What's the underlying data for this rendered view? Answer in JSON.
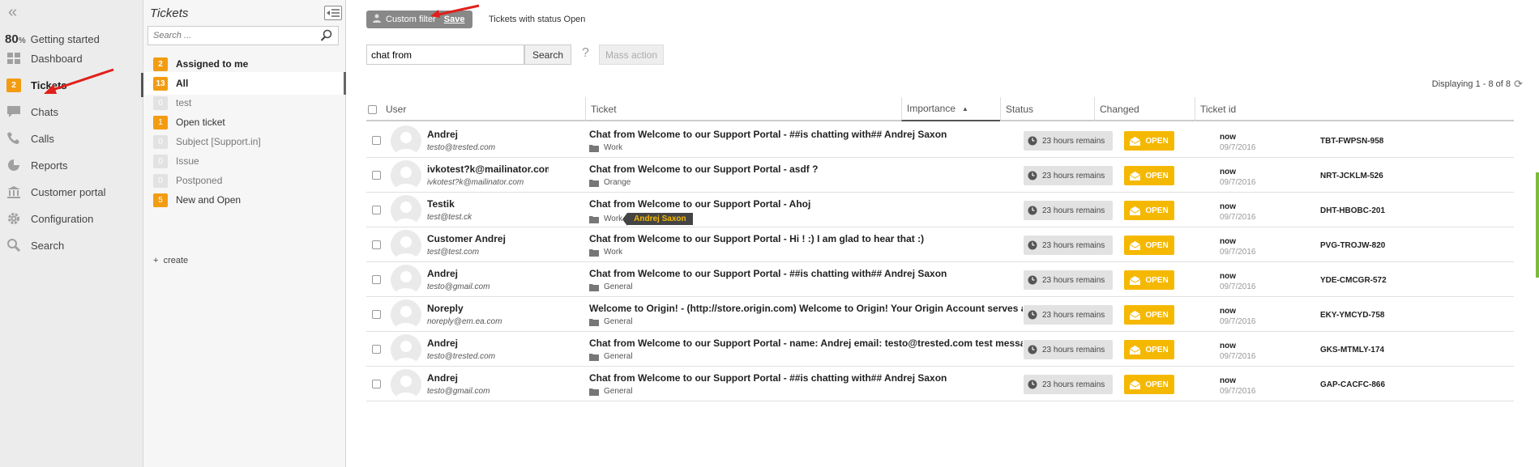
{
  "nav": {
    "collapse_icon": "double-chevron-left-icon",
    "progress": {
      "value": "80",
      "unit": "%",
      "label": "Getting started"
    },
    "items": [
      {
        "label": "Dashboard",
        "icon": "dashboard-icon"
      },
      {
        "label": "Tickets",
        "icon": "ticket-icon",
        "badge": "2"
      },
      {
        "label": "Chats",
        "icon": "chat-bubble-icon"
      },
      {
        "label": "Calls",
        "icon": "phone-icon"
      },
      {
        "label": "Reports",
        "icon": "pie-chart-icon"
      },
      {
        "label": "Customer portal",
        "icon": "bank-building-icon"
      },
      {
        "label": "Configuration",
        "icon": "gear-icon"
      },
      {
        "label": "Search",
        "icon": "search-icon"
      }
    ]
  },
  "filters": {
    "title": "Tickets",
    "search_placeholder": "Search ...",
    "items": [
      {
        "count": "2",
        "label": "Assigned to me"
      },
      {
        "count": "13",
        "label": "All"
      },
      {
        "count": "0",
        "label": "test"
      },
      {
        "count": "1",
        "label": "Open ticket"
      },
      {
        "count": "0",
        "label": "Subject [Support.in]"
      },
      {
        "count": "0",
        "label": "Issue"
      },
      {
        "count": "0",
        "label": "Postponed"
      },
      {
        "count": "5",
        "label": "New and Open"
      }
    ],
    "create_label": "create"
  },
  "toolbar": {
    "custom_filter_label": "Custom filter",
    "save_label": "Save",
    "status_text": "Tickets with status Open",
    "query": "chat from",
    "search_label": "Search",
    "help_label": "?",
    "mass_action_label": "Mass action",
    "displaying": "Displaying 1 - 8 of 8"
  },
  "table": {
    "columns": {
      "user": "User",
      "ticket": "Ticket",
      "importance": "Importance",
      "status": "Status",
      "changed": "Changed",
      "ticket_id": "Ticket id"
    },
    "rows": [
      {
        "name": "Andrej",
        "email": "testo@trested.com",
        "subject": "Chat from Welcome to our Support Portal - ##is chatting with## Andrej Saxon",
        "folder": "Work",
        "tag": "",
        "importance": "23 hours remains",
        "status": "OPEN",
        "changed": "now",
        "date": "09/7/2016",
        "id": "TBT-FWPSN-958"
      },
      {
        "name": "ivkotest?k@mailinator.com",
        "email": "ivkotest?k@mailinator.com",
        "subject": "Chat from Welcome to our Support Portal - asdf ?",
        "folder": "Orange",
        "tag": "",
        "importance": "23 hours remains",
        "status": "OPEN",
        "changed": "now",
        "date": "09/7/2016",
        "id": "NRT-JCKLM-526"
      },
      {
        "name": "Testik",
        "email": "test@test.ck",
        "subject": "Chat from Welcome to our Support Portal - Ahoj",
        "folder": "Work",
        "tag": "Andrej Saxon",
        "importance": "23 hours remains",
        "status": "OPEN",
        "changed": "now",
        "date": "09/7/2016",
        "id": "DHT-HBOBC-201"
      },
      {
        "name": "Customer Andrej",
        "email": "test@test.com",
        "subject": "Chat from Welcome to our Support Portal - Hi ! :) I am glad to hear that :)",
        "folder": "Work",
        "tag": "",
        "importance": "23 hours remains",
        "status": "OPEN",
        "changed": "now",
        "date": "09/7/2016",
        "id": "PVG-TROJW-820"
      },
      {
        "name": "Andrej",
        "email": "testo@gmail.com",
        "subject": "Chat from Welcome to our Support Portal - ##is chatting with## Andrej Saxon",
        "folder": "General",
        "tag": "",
        "importance": "23 hours remains",
        "status": "OPEN",
        "changed": "now",
        "date": "09/7/2016",
        "id": "YDE-CMCGR-572"
      },
      {
        "name": "Noreply",
        "email": "noreply@em.ea.com",
        "subject": "Welcome to Origin! - (http://store.origin.com) Welcome to Origin! Your Origin Account serves as an all-access",
        "folder": "General",
        "tag": "",
        "importance": "23 hours remains",
        "status": "OPEN",
        "changed": "now",
        "date": "09/7/2016",
        "id": "EKY-YMCYD-758"
      },
      {
        "name": "Andrej",
        "email": "testo@trested.com",
        "subject": "Chat from Welcome to our Support Portal - name: Andrej email: testo@trested.com test message andrej",
        "folder": "General",
        "tag": "",
        "importance": "23 hours remains",
        "status": "OPEN",
        "changed": "now",
        "date": "09/7/2016",
        "id": "GKS-MTMLY-174"
      },
      {
        "name": "Andrej",
        "email": "testo@gmail.com",
        "subject": "Chat from Welcome to our Support Portal - ##is chatting with## Andrej Saxon",
        "folder": "General",
        "tag": "",
        "importance": "23 hours remains",
        "status": "OPEN",
        "changed": "now",
        "date": "09/7/2016",
        "id": "GAP-CACFC-866"
      }
    ]
  },
  "colors": {
    "accent": "#f5b800",
    "badge": "#f39c12",
    "annotation_arrow": "#e0201b"
  }
}
